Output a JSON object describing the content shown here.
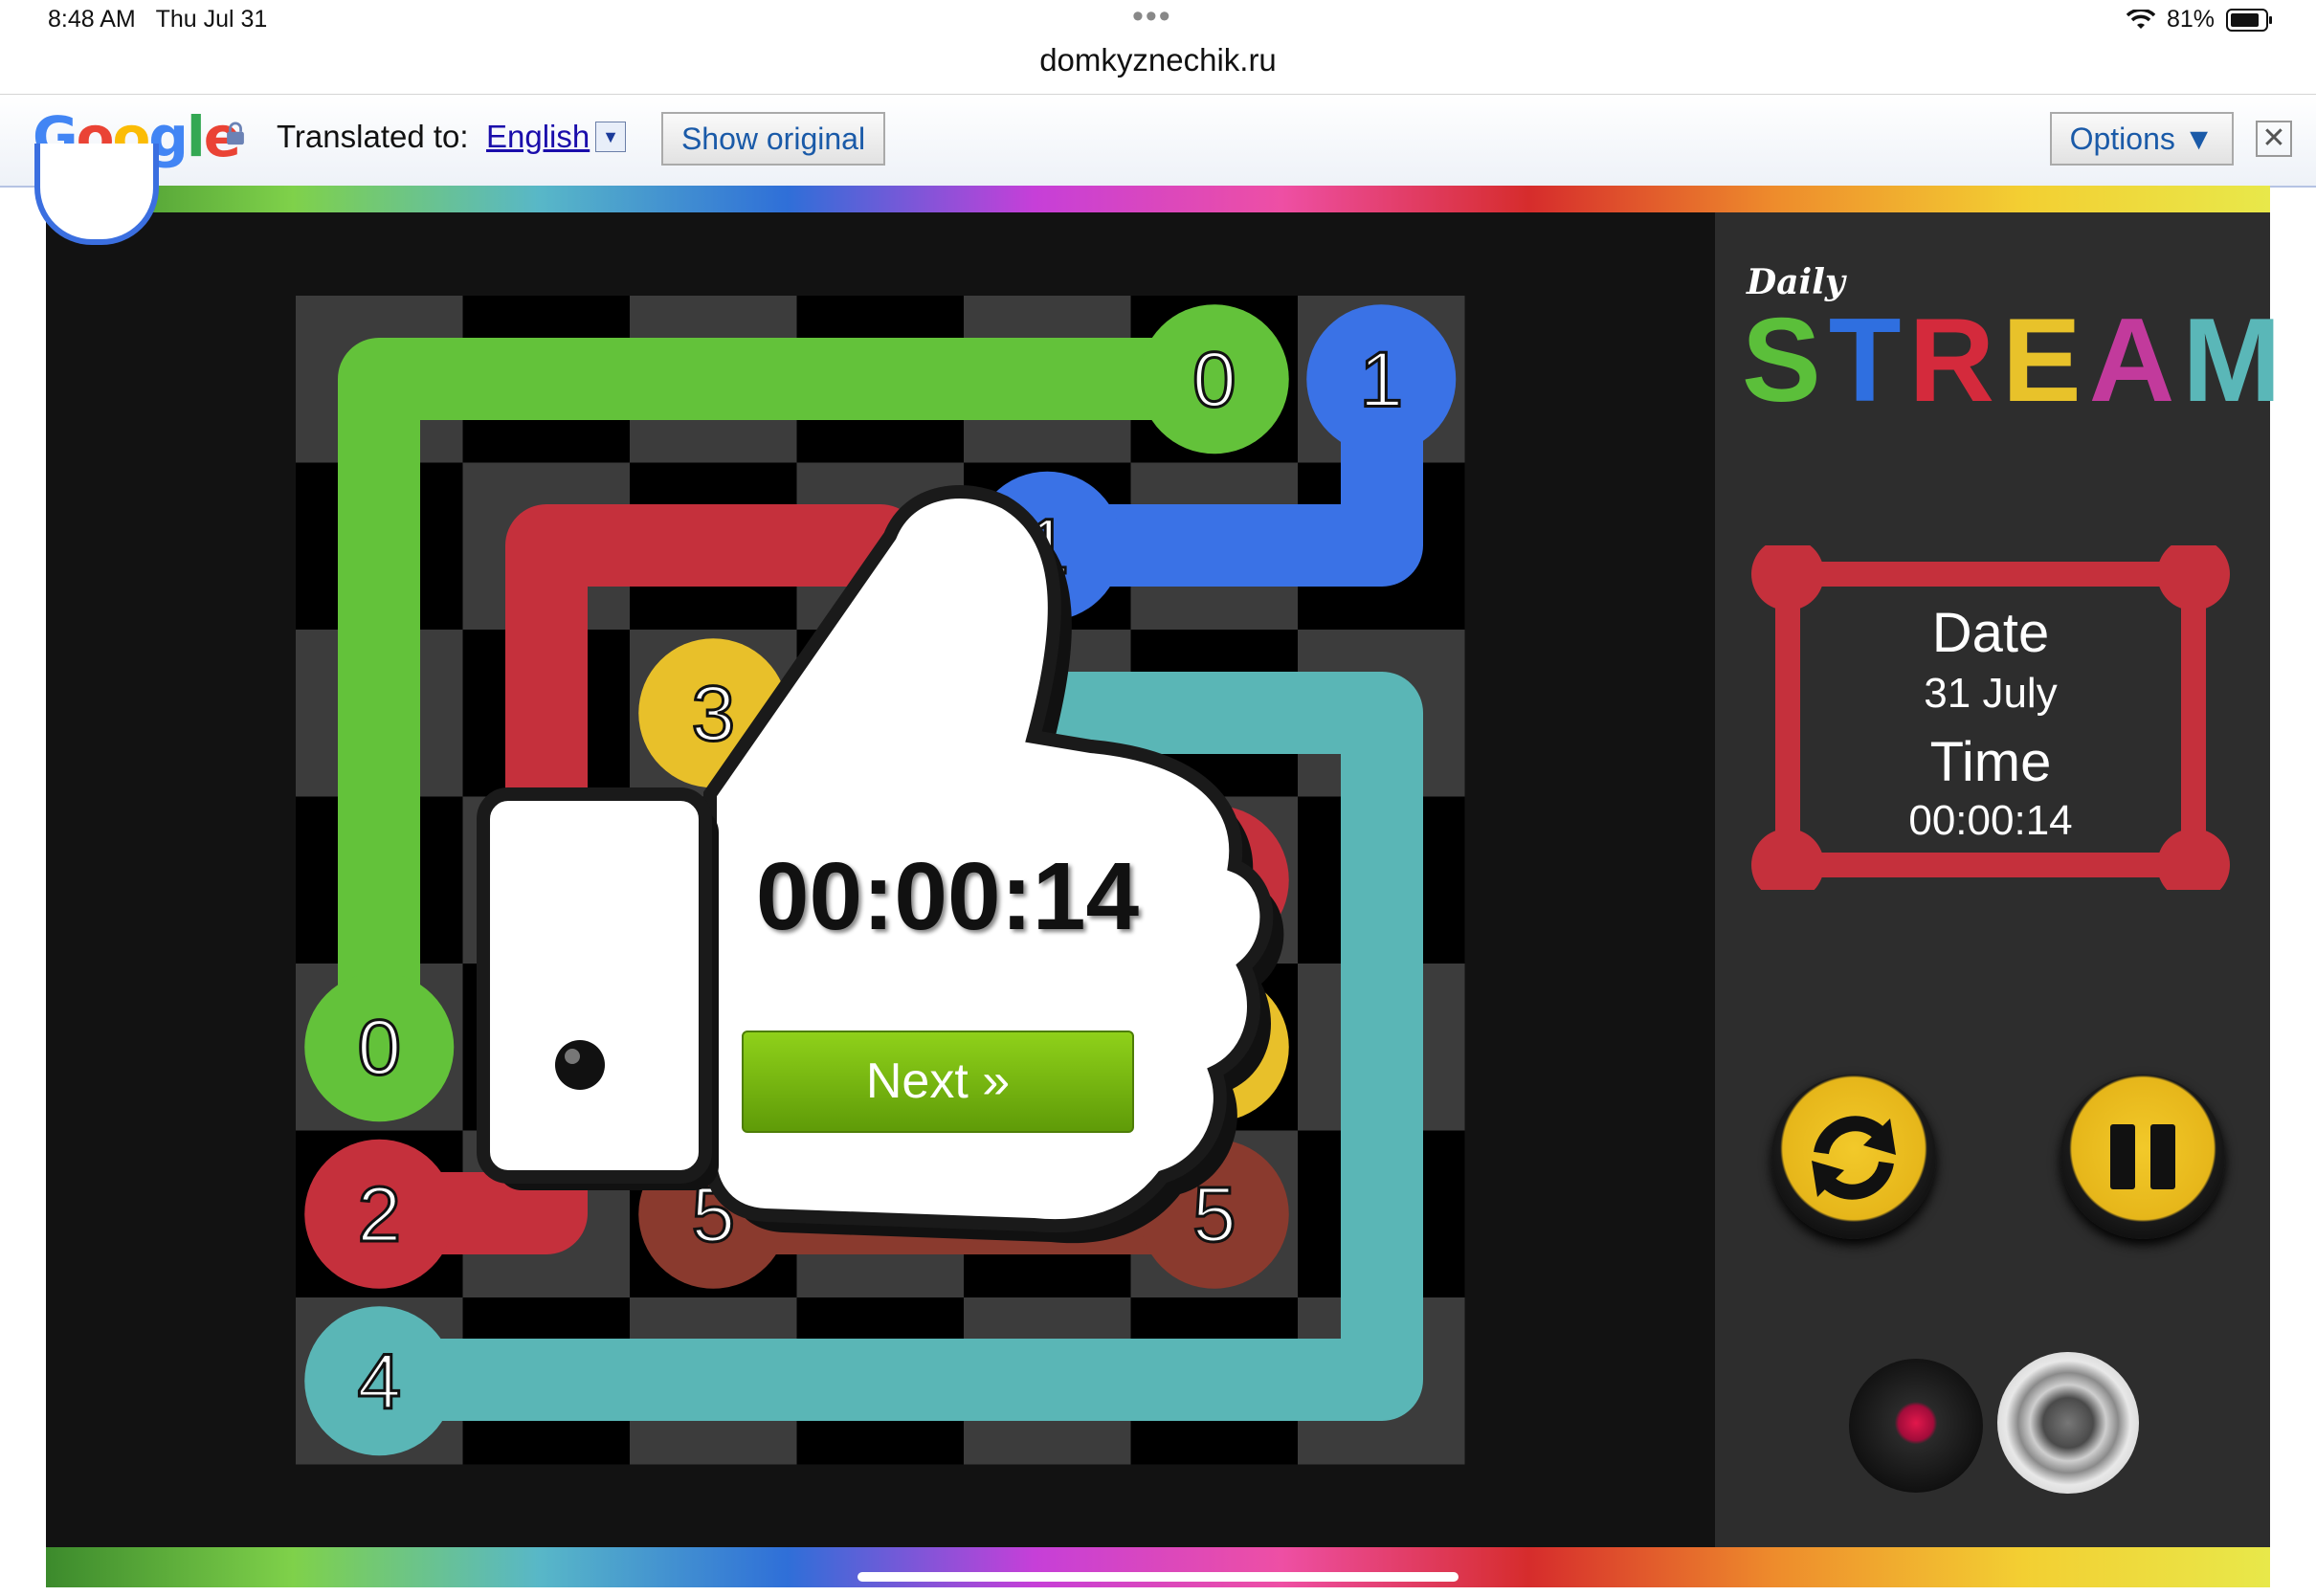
{
  "status_bar": {
    "time": "8:48 AM",
    "date": "Thu Jul 31",
    "battery": "81%",
    "wifi_icon": "wifi-icon"
  },
  "browser": {
    "url": "domkyznechik.ru"
  },
  "translate_bar": {
    "logo_text": "Google",
    "label": "Translated to:",
    "language": "English",
    "show_original": "Show original",
    "options": "Options ▼",
    "close": "✕"
  },
  "game": {
    "logo_small": "Daily",
    "logo_letters": [
      "S",
      "T",
      "R",
      "E",
      "A",
      "M"
    ],
    "logo_colors": [
      "#5bbf3a",
      "#2f6fe0",
      "#d42a3c",
      "#e8c22a",
      "#c23a9c",
      "#5ab7b8"
    ],
    "date_label": "Date",
    "date_value": "31 July",
    "time_label": "Time",
    "time_value": "00:00:14",
    "board": {
      "cols": 7,
      "rows": 7,
      "dots": [
        {
          "label": "0",
          "color": "#63c23a",
          "col": 5,
          "row": 0
        },
        {
          "label": "1",
          "color": "#3a72e6",
          "col": 6,
          "row": 0
        },
        {
          "label": "1",
          "color": "#3a72e6",
          "col": 4,
          "row": 1
        },
        {
          "label": "3",
          "color": "#e8c02a",
          "col": 2,
          "row": 2
        },
        {
          "label": "0",
          "color": "#63c23a",
          "col": 0,
          "row": 4
        },
        {
          "label": "3",
          "color": "#e8c02a",
          "col": 5,
          "row": 4
        },
        {
          "label": "2",
          "color": "#c5303c",
          "col": 0,
          "row": 5
        },
        {
          "label": "5",
          "color": "#8a3a2e",
          "col": 2,
          "row": 5
        },
        {
          "label": "5",
          "color": "#8a3a2e",
          "col": 5,
          "row": 5
        },
        {
          "label": "4",
          "color": "#5ab6b6",
          "col": 0,
          "row": 6
        },
        {
          "label": "2",
          "color": "#c5303c",
          "col": 5,
          "row": 3
        }
      ]
    },
    "popup": {
      "timer": "00:00:14",
      "next": "Next »"
    },
    "controls": {
      "refresh_icon": "refresh-icon",
      "pause_icon": "pause-icon",
      "record_icon": "record-icon",
      "speaker_icon": "speaker-icon"
    }
  }
}
